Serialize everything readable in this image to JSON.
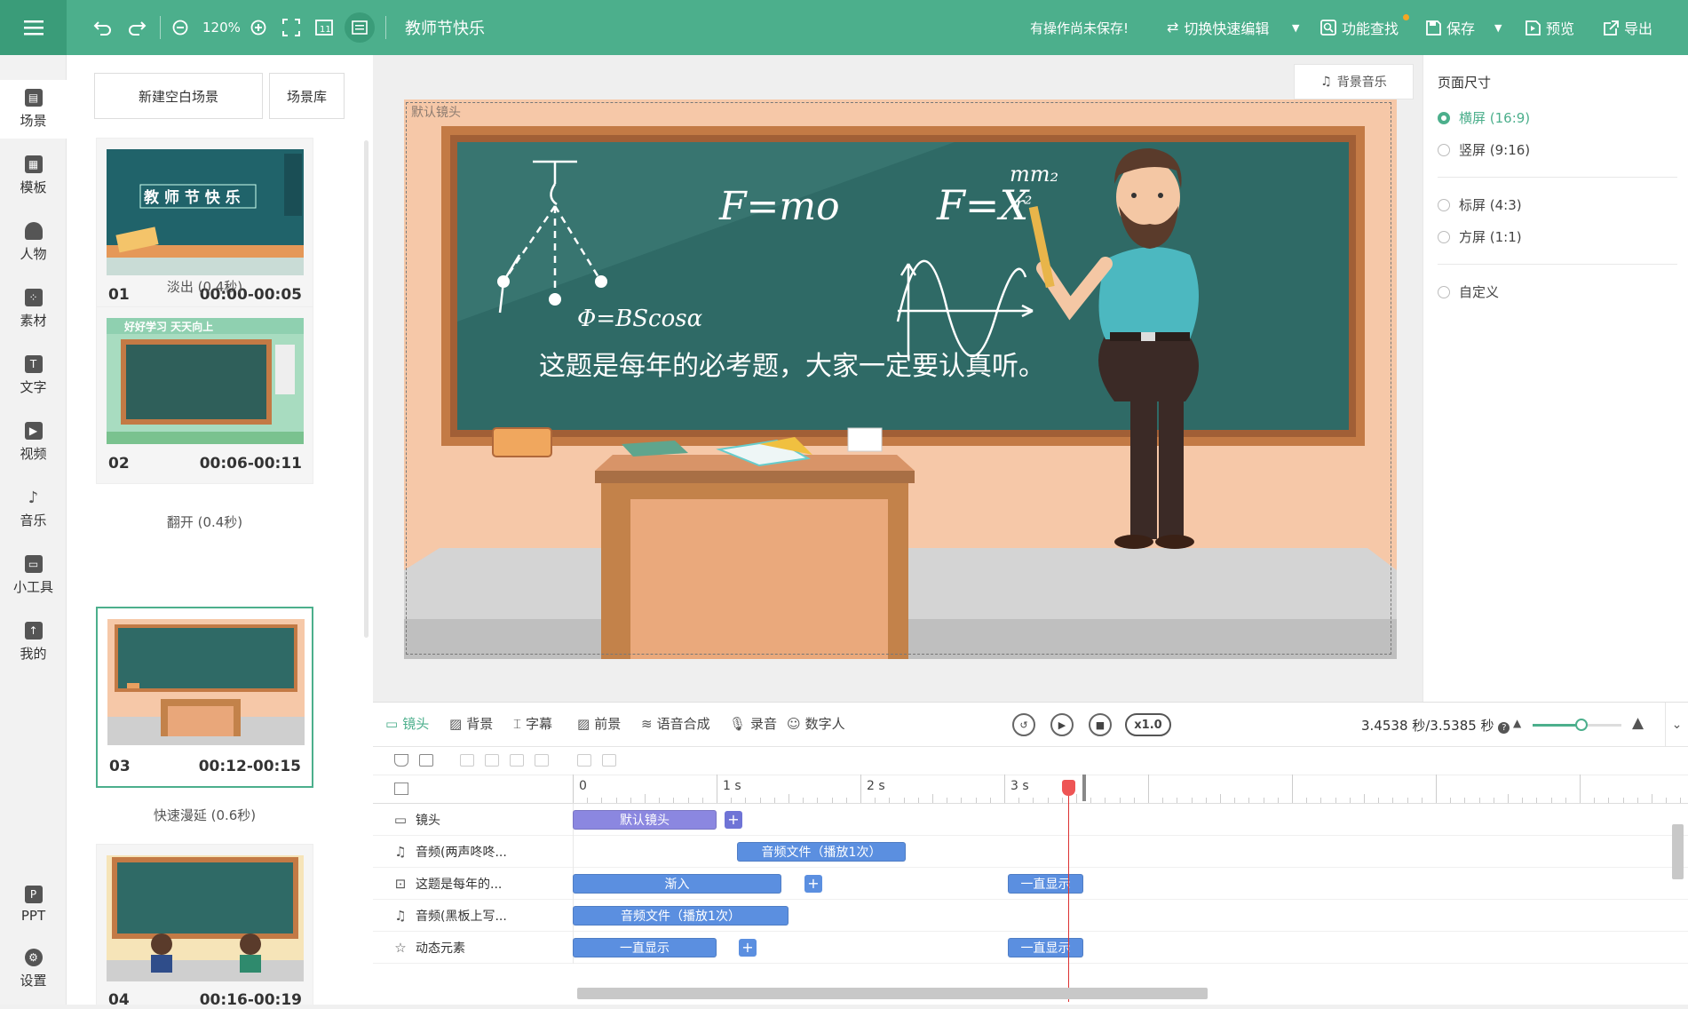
{
  "toolbar": {
    "zoom": "120%",
    "title": "教师节快乐",
    "unsaved": "有操作尚未保存!",
    "quick_edit": "切换快速编辑",
    "find": "功能查找",
    "save": "保存",
    "preview": "预览",
    "export": "导出"
  },
  "nav": [
    {
      "label": "场景",
      "icon": "scene-icon"
    },
    {
      "label": "模板",
      "icon": "template-icon"
    },
    {
      "label": "人物",
      "icon": "person-icon"
    },
    {
      "label": "素材",
      "icon": "material-icon"
    },
    {
      "label": "文字",
      "icon": "text-icon"
    },
    {
      "label": "视频",
      "icon": "video-icon"
    },
    {
      "label": "音乐",
      "icon": "music-icon"
    },
    {
      "label": "小工具",
      "icon": "toolbox-icon"
    },
    {
      "label": "我的",
      "icon": "upload-icon"
    },
    {
      "label": "PPT",
      "icon": "ppt-icon"
    },
    {
      "label": "设置",
      "icon": "gear-icon"
    }
  ],
  "scenes": {
    "new_blank": "新建空白场景",
    "library": "场景库",
    "items": [
      {
        "num": "01",
        "time": "00:00-00:05",
        "transition": "淡出 (0.4秒)"
      },
      {
        "num": "02",
        "time": "00:06-00:11",
        "transition": "翻开 (0.4秒)"
      },
      {
        "num": "03",
        "time": "00:12-00:15",
        "transition": "快速漫延 (0.6秒)"
      },
      {
        "num": "04",
        "time": "00:16-00:19",
        "transition": ""
      }
    ]
  },
  "thumbs": {
    "t1_title": "教 师 节 快 乐",
    "t2_banner": "好好学习   天天向上"
  },
  "canvas": {
    "bgm": "背景音乐",
    "lens_label": "默认镜头",
    "board_text": "这题是每年的必考题，大家一定要认真听。",
    "formula1": "F=mo",
    "formula2": "F=X",
    "formula3": "mm₂",
    "formula4": "r²",
    "formula5": "Φ=BScosα"
  },
  "page_size": {
    "title": "页面尺寸",
    "options": [
      "横屏 (16:9)",
      "竖屏 (9:16)",
      "标屏 (4:3)",
      "方屏 (1:1)",
      "自定义"
    ],
    "selected": "横屏 (16:9)"
  },
  "timeline": {
    "tabs": [
      "镜头",
      "背景",
      "字幕",
      "前景",
      "语音合成",
      "录音",
      "数字人"
    ],
    "speed": "x1.0",
    "time": "3.4538 秒/3.5385 秒",
    "ruler": [
      "0",
      "1 s",
      "2 s",
      "3 s"
    ],
    "zoom_level": 0.55,
    "tracks": [
      {
        "label": "镜头",
        "icon": "camera-icon",
        "clips": [
          "默认镜头"
        ]
      },
      {
        "label": "音频(两声咚咚...",
        "icon": "music-note-icon",
        "clips": [
          "音频文件（播放1次）"
        ]
      },
      {
        "label": "这题是每年的...",
        "icon": "text-box-icon",
        "clips": [
          "渐入",
          "一直显示"
        ]
      },
      {
        "label": "音频(黑板上写...",
        "icon": "music-note-icon",
        "clips": [
          "音频文件（播放1次）"
        ]
      },
      {
        "label": "动态元素",
        "icon": "star-icon",
        "clips": [
          "一直显示",
          "一直显示"
        ]
      }
    ]
  },
  "colors": {
    "accent": "#4caf8c",
    "board": "#2f6a66",
    "clip_blue": "#5b8fe0",
    "clip_lens": "#8b87e0"
  }
}
